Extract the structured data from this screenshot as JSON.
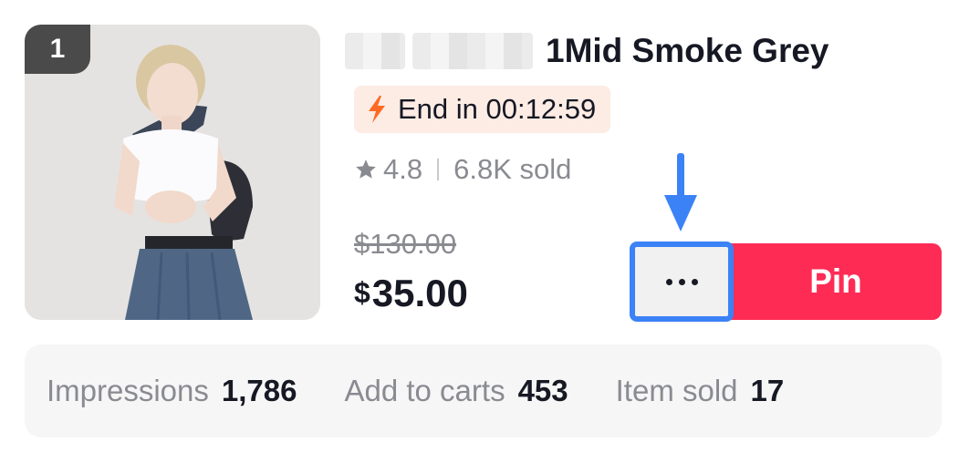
{
  "product": {
    "rank": "1",
    "title": "1Mid Smoke Grey",
    "flash_sale": {
      "icon": "lightning-bolt-icon",
      "text": "End in 00:12:59",
      "color": "#fe6a23"
    },
    "rating": {
      "icon": "star-icon",
      "score": "4.8",
      "sold": "6.8K sold"
    },
    "original_price": "$130.00",
    "price_currency": "$",
    "price_amount": "35.00"
  },
  "actions": {
    "more_icon": "ellipsis-icon",
    "pin_label": "Pin",
    "pin_color": "#fe2c55",
    "highlight_color": "#3b82f6"
  },
  "stats": [
    {
      "label": "Impressions",
      "value": "1,786"
    },
    {
      "label": "Add to carts",
      "value": "453"
    },
    {
      "label": "Item sold",
      "value": "17"
    }
  ]
}
